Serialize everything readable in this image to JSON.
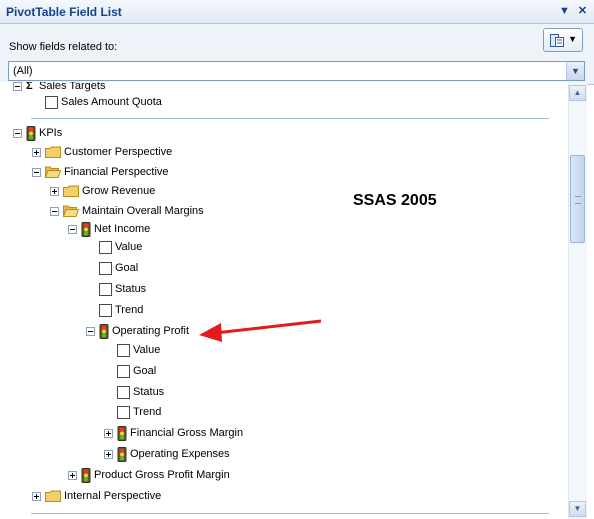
{
  "window": {
    "title": "PivotTable Field List",
    "controls": [
      "dropdown-icon",
      "close-icon"
    ]
  },
  "filter": {
    "label": "Show fields related to:",
    "value": "(All)"
  },
  "annotation": {
    "text": "SSAS 2005",
    "arrow_color": "#e31b1b"
  },
  "tree": {
    "partial_group": "Sales Targets",
    "sales_amount_quota": "Sales Amount Quota",
    "kpis": "KPIs",
    "customer_perspective": "Customer Perspective",
    "financial_perspective": "Financial Perspective",
    "grow_revenue": "Grow Revenue",
    "maintain_overall_margins": "Maintain Overall Margins",
    "net_income": "Net Income",
    "ni_value": "Value",
    "ni_goal": "Goal",
    "ni_status": "Status",
    "ni_trend": "Trend",
    "operating_profit": "Operating Profit",
    "op_value": "Value",
    "op_goal": "Goal",
    "op_status": "Status",
    "op_trend": "Trend",
    "financial_gross_margin": "Financial Gross Margin",
    "operating_expenses": "Operating Expenses",
    "product_gross_profit_margin": "Product Gross Profit Margin",
    "internal_perspective": "Internal Perspective"
  },
  "colors": {
    "title_text": "#15428b",
    "folder": "#f3cf67",
    "accent_border": "#7f9db9"
  }
}
